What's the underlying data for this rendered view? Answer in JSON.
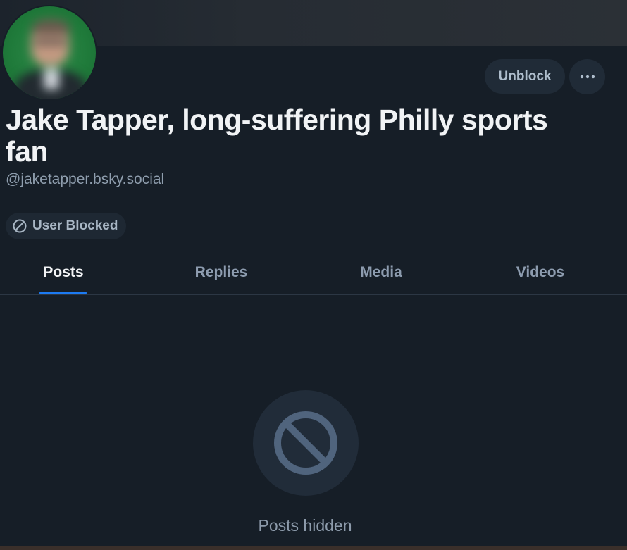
{
  "profile": {
    "display_name": "Jake Tapper, long-suffering Philly sports fan",
    "handle": "@jaketapper.bsky.social",
    "blocked_label": "User Blocked"
  },
  "actions": {
    "unblock_label": "Unblock",
    "more_icon": "ellipsis-icon"
  },
  "tabs": [
    {
      "label": "Posts",
      "active": true
    },
    {
      "label": "Replies",
      "active": false
    },
    {
      "label": "Media",
      "active": false
    },
    {
      "label": "Videos",
      "active": false
    }
  ],
  "empty_state": {
    "icon": "blocked-icon",
    "label": "Posts hidden"
  },
  "colors": {
    "background": "#161e27",
    "accent": "#1d7bf2",
    "text_primary": "#f1f3f5",
    "text_muted": "#8d9caf"
  }
}
